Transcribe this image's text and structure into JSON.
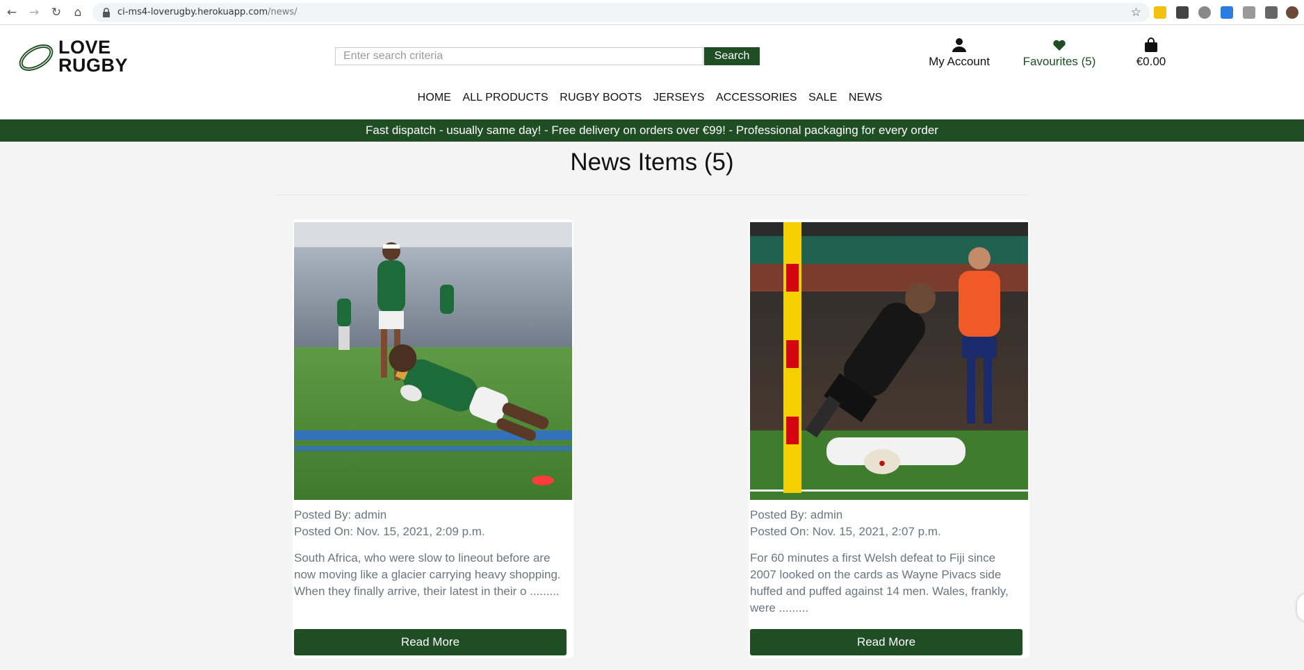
{
  "browser": {
    "url_host": "ci-ms4-loverugby.herokuapp.com",
    "url_path": "/news/"
  },
  "site": {
    "logo_line1": "LOVE",
    "logo_line2": "RUGBY",
    "search": {
      "placeholder": "Enter search criteria",
      "button_label": "Search"
    },
    "account_label": "My Account",
    "favourites_label": "Favourites (5)",
    "cart_total": "€0.00",
    "nav": [
      "HOME",
      "ALL PRODUCTS",
      "RUGBY BOOTS",
      "JERSEYS",
      "ACCESSORIES",
      "SALE",
      "NEWS"
    ],
    "banner": "Fast dispatch - usually same day! - Free delivery on orders over €99! - Professional packaging for every order"
  },
  "page": {
    "title": "News Items (5)",
    "items": [
      {
        "posted_by": "Posted By: admin",
        "posted_on": "Posted On: Nov. 15, 2021, 2:09 p.m.",
        "excerpt": "South Africa, who were slow to lineout before are now moving like a glacier carrying heavy shopping. When they finally arrive, their latest in their o .........",
        "button": "Read More"
      },
      {
        "posted_by": "Posted By: admin",
        "posted_on": "Posted On: Nov. 15, 2021, 2:07 p.m.",
        "excerpt": "For 60 minutes a first Welsh defeat to Fiji since 2007 looked on the cards as Wayne Pivacs side huffed and puffed against 14 men. Wales, frankly, were .........",
        "button": "Read More"
      }
    ]
  },
  "colors": {
    "brand_green": "#1f4e24",
    "muted_text": "#6c757d"
  }
}
